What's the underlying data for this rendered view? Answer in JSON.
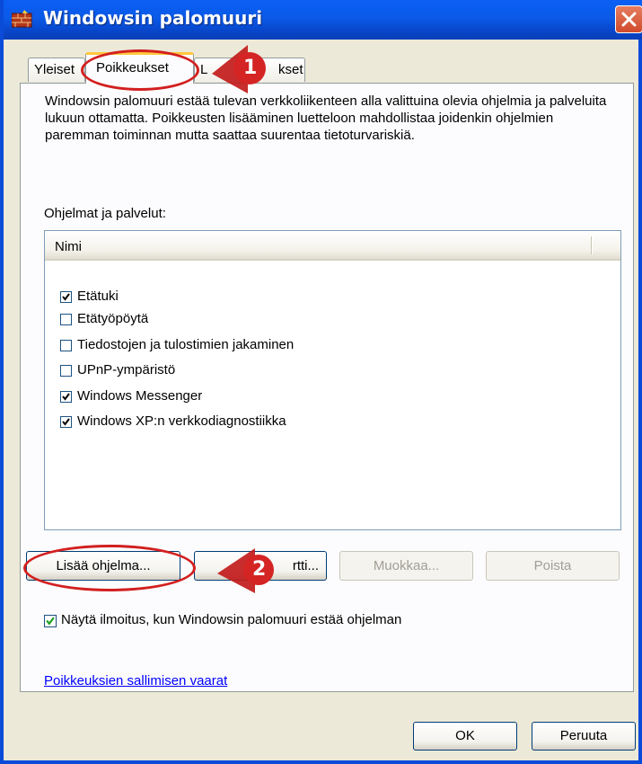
{
  "window": {
    "title": "Windowsin palomuuri",
    "accent": "#0a5ff3",
    "close_color": "#d6543a"
  },
  "tabs": [
    {
      "label": "Yleiset"
    },
    {
      "label": "Poikkeukset",
      "active": true
    },
    {
      "label": "Lisäasetukset",
      "visible_fragments": [
        "L",
        "kset"
      ]
    }
  ],
  "panel": {
    "description": "Windowsin palomuuri estää tulevan verkkoliikenteen alla valittuina olevia ohjelmia ja palveluita lukuun ottamatta. Poikkeusten lisääminen luetteloon mahdollistaa joidenkin ohjelmien paremman toiminnan mutta saattaa suurentaa tietoturvariskiä.",
    "list_label": "Ohjelmat ja palvelut:",
    "list_header": "Nimi",
    "programs": [
      {
        "label": "Etätuki",
        "checked": true
      },
      {
        "label": "Etätyöpöytä",
        "checked": false
      },
      {
        "label": "Tiedostojen ja tulostimien jakaminen",
        "checked": false
      },
      {
        "label": "UPnP-ympäristö",
        "checked": false
      },
      {
        "label": "Windows Messenger",
        "checked": true
      },
      {
        "label": "Windows XP:n verkkodiagnostiikka",
        "checked": true
      }
    ],
    "buttons": {
      "add_program": "Lisää ohjelma...",
      "add_port_fragment": "rtti...",
      "edit": "Muokkaa...",
      "delete": "Poista"
    },
    "notify": {
      "label": "Näytä ilmoitus, kun Windowsin palomuuri estää ohjelman",
      "checked": true
    },
    "link": "Poikkeuksien sallimisen vaarat"
  },
  "footer": {
    "ok": "OK",
    "cancel": "Peruuta"
  },
  "annotations": {
    "marker_1": "1",
    "marker_2": "2",
    "color": "#d21f1f"
  }
}
